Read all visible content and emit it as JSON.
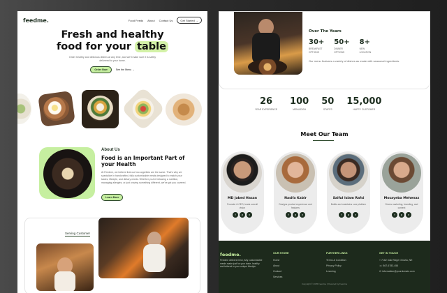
{
  "left_page": {
    "nav": {
      "logo": "feedme.",
      "links": [
        "Food Feeds",
        "About",
        "Contact Us"
      ],
      "cta": "Get Started"
    },
    "hero": {
      "title_line1": "Fresh and healthy",
      "title_line2_prefix": "food for your ",
      "title_highlight": "table",
      "subtitle": "Order healthy and delicious dishes at any time, and we'll make sure it is safely delivered to your home.",
      "primary_button": "Order Now",
      "secondary_link": "See the Menu"
    },
    "about": {
      "eyebrow": "About Us",
      "title": "Food is an Important Part of your Health",
      "body": "At Feedme, we believe that our two appetites are the same. That's why we specialize in handcrafted, fully customizable meals designed to match your tastes, lifestyle, and dietary needs. Whether you're following a nutrition, managing allergies, or just craving something different, we've got you covered.",
      "button": "Learn More"
    },
    "serving": {
      "tab": "Serving Customer"
    }
  },
  "right_page": {
    "over_the_years": {
      "title": "Over The Years",
      "stats": [
        {
          "value": "30+",
          "label": "BREAKFAST OPTIONS"
        },
        {
          "value": "50+",
          "label": "DINNER OPTIONS"
        },
        {
          "value": "8+",
          "label": "NEW LOCATION"
        }
      ],
      "description": "Our menu features a variety of dishes as made with seasonal ingredients."
    },
    "stats_bar": [
      {
        "value": "26",
        "label": "YEAR EXPERIENCE"
      },
      {
        "value": "100",
        "label": "MENU/DISH"
      },
      {
        "value": "50",
        "label": "STAFFS"
      },
      {
        "value": "15,000",
        "label": "HAPPY CUSTOMER"
      }
    ],
    "team": {
      "title": "Meet Our Team",
      "members": [
        {
          "name": "MD Jabed Hasan",
          "role": "Founder & CEO, leads overall vision"
        },
        {
          "name": "Nasifa Kabir",
          "role": "Designs product experience and features"
        },
        {
          "name": "Saiful Islam Rafsi",
          "role": "Builds and maintains core platform"
        },
        {
          "name": "Mosayeba Mehenaz",
          "role": "Drives marketing, branding, and content"
        }
      ],
      "social_icons": [
        "facebook-icon",
        "pinterest-icon",
        "x-icon"
      ]
    },
    "footer": {
      "logo": "feedme.",
      "description": "Feedme delivers fresh, fully customizable meals made just for your taste, healthy and tailored to your unique lifestyle.",
      "columns": [
        {
          "heading": "OUR STORE",
          "items": [
            "Home",
            "About",
            "Contact",
            "Services"
          ]
        },
        {
          "heading": "FURTHER LINKS",
          "items": [
            "Terms & Condition",
            "Privacy Policy",
            "Learning"
          ]
        },
        {
          "heading": "GET IN TOUCH",
          "items": [
            "7162 Oak Ridge Omaha, NE",
            "867-6783-456",
            "information@yourdomain.com"
          ]
        }
      ],
      "copyright": "Copyright © 2025 Feedme | Powered by Feedme"
    }
  },
  "colors": {
    "brand_dark_green": "#1d2e1f",
    "accent_light_green": "#c6efa0",
    "footer_bg": "#1d2a1c"
  }
}
